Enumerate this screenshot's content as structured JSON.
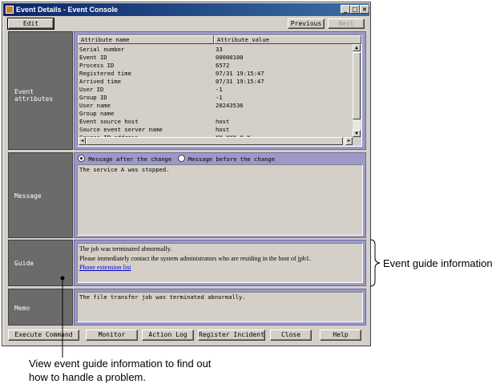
{
  "window": {
    "title": "Event Details - Event Console"
  },
  "titlebar_buttons": [
    {
      "icon": "minimize-icon",
      "glyph": "_"
    },
    {
      "icon": "maximize-icon",
      "glyph": "□"
    },
    {
      "icon": "close-icon",
      "glyph": "×"
    }
  ],
  "toolbar": {
    "edit": "Edit",
    "previous": "Previous",
    "next": "Next"
  },
  "attributes": {
    "label": "Event attributes",
    "col_name": "Attribute name",
    "col_value": "Attribute value",
    "rows": [
      {
        "name": "Serial number",
        "value": "33"
      },
      {
        "name": "Event ID",
        "value": "00000100"
      },
      {
        "name": "Process ID",
        "value": "6572"
      },
      {
        "name": "Registered time",
        "value": "07/31 19:15:47"
      },
      {
        "name": "Arrived time",
        "value": "07/31 19:15:47"
      },
      {
        "name": "User ID",
        "value": "-1"
      },
      {
        "name": "Group ID",
        "value": "-1"
      },
      {
        "name": "User name",
        "value": "20243536"
      },
      {
        "name": "Group name",
        "value": ""
      },
      {
        "name": "Event source host",
        "value": "host"
      },
      {
        "name": "Source event server name",
        "value": "host"
      },
      {
        "name": "Source IP address",
        "value": "XX.XXX.X.X"
      }
    ]
  },
  "message": {
    "label": "Message",
    "radio_after": "Message after the change",
    "radio_before": "Message before the change",
    "text": "The service A was stopped."
  },
  "guide": {
    "label": "Guide",
    "line1": "The job was terminated abnormally.",
    "line2": "Please immediately contact the system administrators who are residing in the host of jpb1.",
    "link": "Phone extension list"
  },
  "memo": {
    "label": "Memo",
    "text": "The file transfer job was terminated abnormally."
  },
  "bottom_buttons": {
    "execute": "Execute Command",
    "monitor": "Monitor",
    "action_log": "Action Log",
    "register": "Register Incident",
    "close": "Close",
    "help": "Help"
  },
  "annotations": {
    "guide_info": "Event guide information",
    "view_line1": "View event guide information to find out",
    "view_line2": "how to handle a problem."
  }
}
